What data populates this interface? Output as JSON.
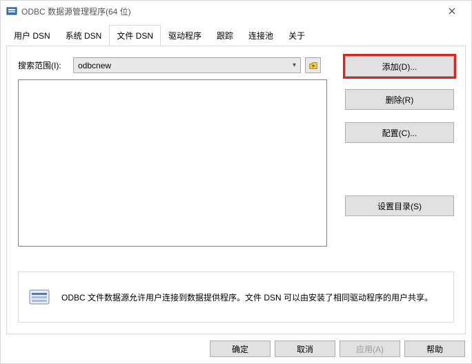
{
  "window": {
    "title": "ODBC 数据源管理程序(64 位)"
  },
  "tabs": {
    "items": [
      {
        "label": "用户 DSN"
      },
      {
        "label": "系统 DSN"
      },
      {
        "label": "文件 DSN"
      },
      {
        "label": "驱动程序"
      },
      {
        "label": "跟踪"
      },
      {
        "label": "连接池"
      },
      {
        "label": "关于"
      }
    ],
    "activeIndex": 2
  },
  "panel": {
    "searchLabel": "搜索范围(I):",
    "searchValue": "odbcnew",
    "buttons": {
      "add": "添加(D)...",
      "remove": "删除(R)",
      "configure": "配置(C)...",
      "setDir": "设置目录(S)"
    },
    "infoText": "ODBC 文件数据源允许用户连接到数据提供程序。文件 DSN 可以由安装了相同驱动程序的用户共享。"
  },
  "footer": {
    "ok": "确定",
    "cancel": "取消",
    "apply": "应用(A)",
    "help": "帮助"
  }
}
